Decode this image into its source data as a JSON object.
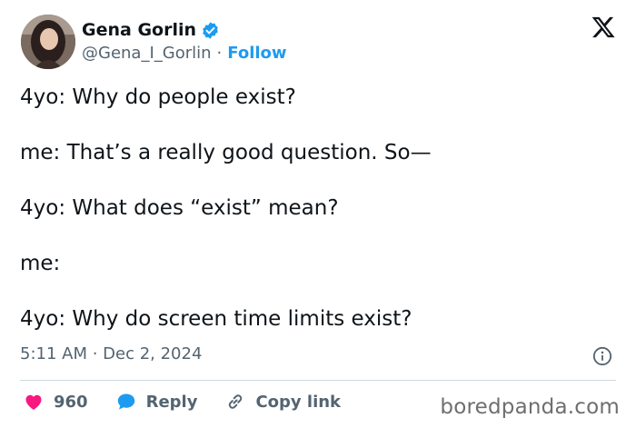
{
  "author": {
    "name": "Gena Gorlin",
    "handle": "@Gena_I_Gorlin",
    "separator": "·",
    "follow_label": "Follow",
    "verified_color": "#1d9bf0"
  },
  "icons": {
    "platform": "x-logo-icon",
    "verified": "verified-badge-icon",
    "info": "info-icon",
    "like": "heart-icon",
    "reply": "reply-bubble-icon",
    "copy": "link-icon"
  },
  "tweet": {
    "lines": [
      "4yo: Why do people exist?",
      "me: That’s a really good question. So—",
      "4yo: What does “exist” mean?",
      "me:",
      "4yo: Why do screen time limits exist?"
    ],
    "timestamp": "5:11 AM · Dec 2, 2024"
  },
  "actions": {
    "like_count": "960",
    "like_color": "#f91880",
    "reply_label": "Reply",
    "reply_color": "#1d9bf0",
    "copy_label": "Copy link"
  },
  "watermark": "boredpanda.com"
}
